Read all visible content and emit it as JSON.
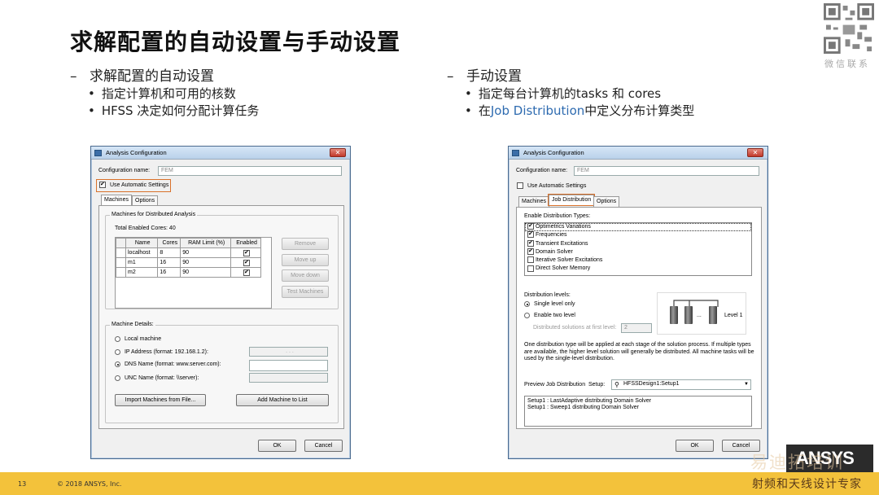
{
  "slide": {
    "title": "求解配置的自动设置与手动设置",
    "qr_caption": "微信联系",
    "page_number": "13",
    "copyright": "© 2018 ANSYS, Inc.",
    "brand": "ANSYS",
    "watermark_top": "易迪拓培训",
    "watermark_bottom": "射频和天线设计专家",
    "accent_color": "#f3c23b",
    "highlight_color": "#d9712b"
  },
  "left_bullets": {
    "heading": "求解配置的自动设置",
    "items": [
      "指定计算机和可用的核数",
      "HFSS 决定如何分配计算任务"
    ]
  },
  "right_bullets": {
    "heading": "手动设置",
    "item1": "指定每台计算机的tasks 和 cores",
    "item2_prefix": "在",
    "item2_highlight": "Job Distribution",
    "item2_suffix": "中定义分布计算类型"
  },
  "dialog_left": {
    "title": "Analysis Configuration",
    "config_name_label": "Configuration name:",
    "config_name_value": "FEM",
    "use_auto_label": "Use Automatic Settings",
    "tabs": [
      "Machines",
      "Options"
    ],
    "group_title": "Machines for Distributed Analysis",
    "total_cores": "Total Enabled Cores: 40",
    "columns": [
      "Name",
      "Cores",
      "RAM Limit (%)",
      "Enabled"
    ],
    "rows": [
      {
        "name": "localhost",
        "cores": "8",
        "ram": "90"
      },
      {
        "name": "m1",
        "cores": "16",
        "ram": "90"
      },
      {
        "name": "m2",
        "cores": "16",
        "ram": "90"
      }
    ],
    "side_buttons": [
      "Remove",
      "Move up",
      "Move down",
      "Test Machines"
    ],
    "details_title": "Machine Details:",
    "radio_local": "Local machine",
    "radio_ip": "IP Address (format: 192.168.1.2):",
    "ip_dots": ". . .",
    "radio_dns": "DNS Name (format: www.server.com):",
    "radio_unc": "UNC Name (format: \\\\server):",
    "import_button": "Import Machines from File...",
    "add_button": "Add Machine to List",
    "ok": "OK",
    "cancel": "Cancel"
  },
  "dialog_right": {
    "title": "Analysis Configuration",
    "config_name_label": "Configuration name:",
    "config_name_value": "FEM",
    "use_auto_label": "Use Automatic Settings",
    "tabs": [
      "Machines",
      "Job Distribution",
      "Options"
    ],
    "enable_types_label": "Enable Distribution Types:",
    "types": [
      {
        "label": "Optimetrics Variations",
        "checked": true
      },
      {
        "label": "Frequencies",
        "checked": true
      },
      {
        "label": "Transient Excitations",
        "checked": true
      },
      {
        "label": "Domain Solver",
        "checked": true
      },
      {
        "label": "Iterative Solver Excitations",
        "checked": false
      },
      {
        "label": "Direct Solver Memory",
        "checked": false
      }
    ],
    "levels_label": "Distribution levels:",
    "single_level": "Single level only",
    "two_level": "Enable two level",
    "first_level_label": "Distributed solutions at first level:",
    "first_level_value": "2",
    "level_image_label": "Level 1",
    "level_ellipsis": "...",
    "description": "One distribution type will be applied at each stage of the solution process. If multiple types are available, the higher level solution will generally be distributed. All machine tasks will be used by the single-level distribution.",
    "preview_label": "Preview Job Distribution",
    "setup_label": "Setup:",
    "setup_value": "HFSSDesign1:Setup1",
    "preview_lines": [
      "Setup1 : LastAdaptive distributing Domain Solver",
      "Setup1 : Sweep1 distributing Domain Solver"
    ],
    "ok": "OK",
    "cancel": "Cancel"
  }
}
